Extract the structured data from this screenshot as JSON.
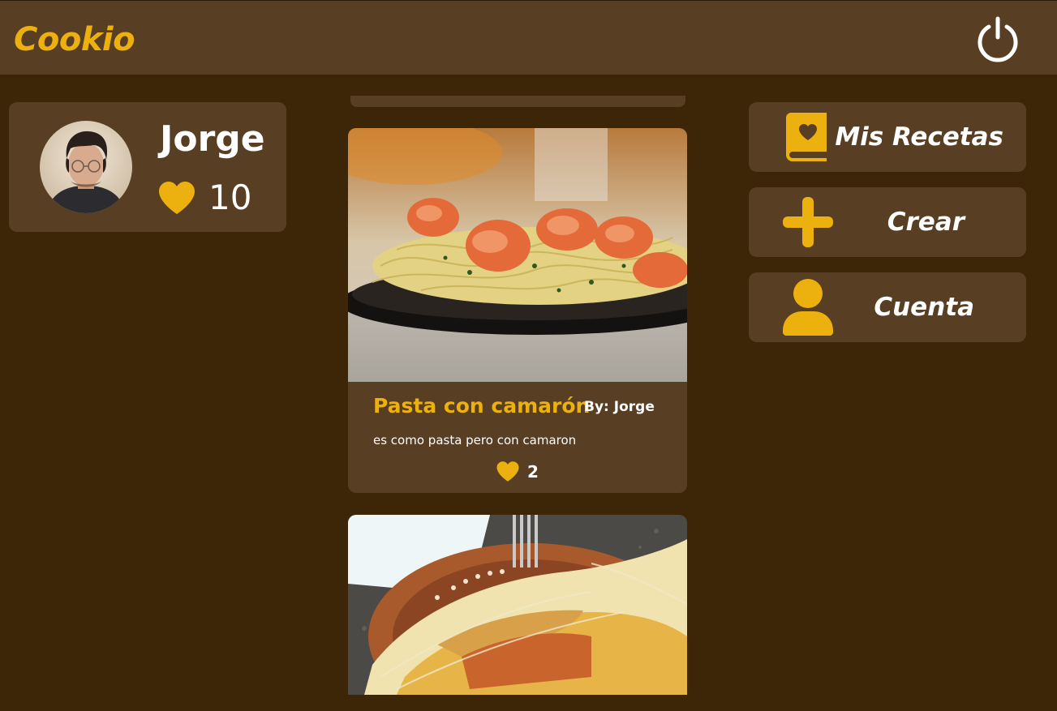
{
  "header": {
    "brand": "Cookio",
    "power_icon": "power-icon"
  },
  "profile": {
    "name": "Jorge",
    "likes": "10"
  },
  "feed": {
    "posts": [
      {
        "title": "Pasta con camarón",
        "author": "By: Jorge",
        "description": "es como pasta pero con camaron",
        "likes": "2"
      }
    ]
  },
  "menu": {
    "items": [
      {
        "label": "Mis Recetas",
        "icon": "heart-book-icon"
      },
      {
        "label": "Crear",
        "icon": "plus-icon"
      },
      {
        "label": "Cuenta",
        "icon": "user-icon"
      }
    ]
  },
  "colors": {
    "accent": "#ecb10f",
    "background": "#3d2508",
    "panel": "#583e22",
    "text": "#ffffff"
  }
}
